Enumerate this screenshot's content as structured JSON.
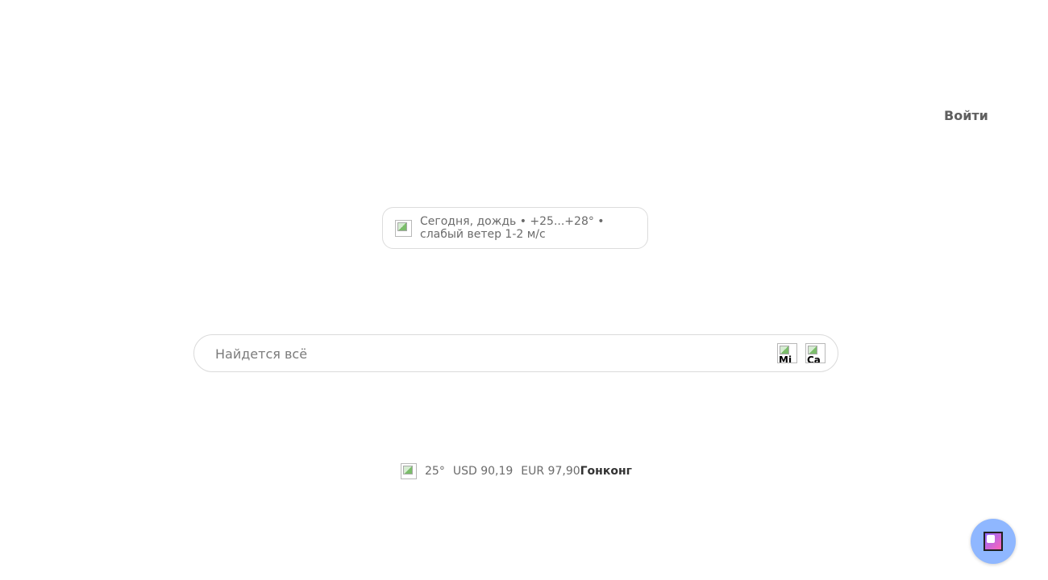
{
  "header": {
    "login_label": "Войти"
  },
  "weather": {
    "text": "Сегодня, дождь • +25...+28° • слабый ветер 1-2 м/с",
    "icon": "weather-image-broken"
  },
  "search": {
    "placeholder": "Найдется всё",
    "mic_icon_label": "Mi",
    "camera_icon_label": "Ca"
  },
  "info_line": {
    "temperature": "25°",
    "usd": "USD 90,19",
    "eur": "EUR 97,90",
    "city": "Гонконг"
  },
  "colors": {
    "accent_blue": "#8fb7ff",
    "text_muted": "#6b6b6b",
    "border": "#dadada"
  }
}
